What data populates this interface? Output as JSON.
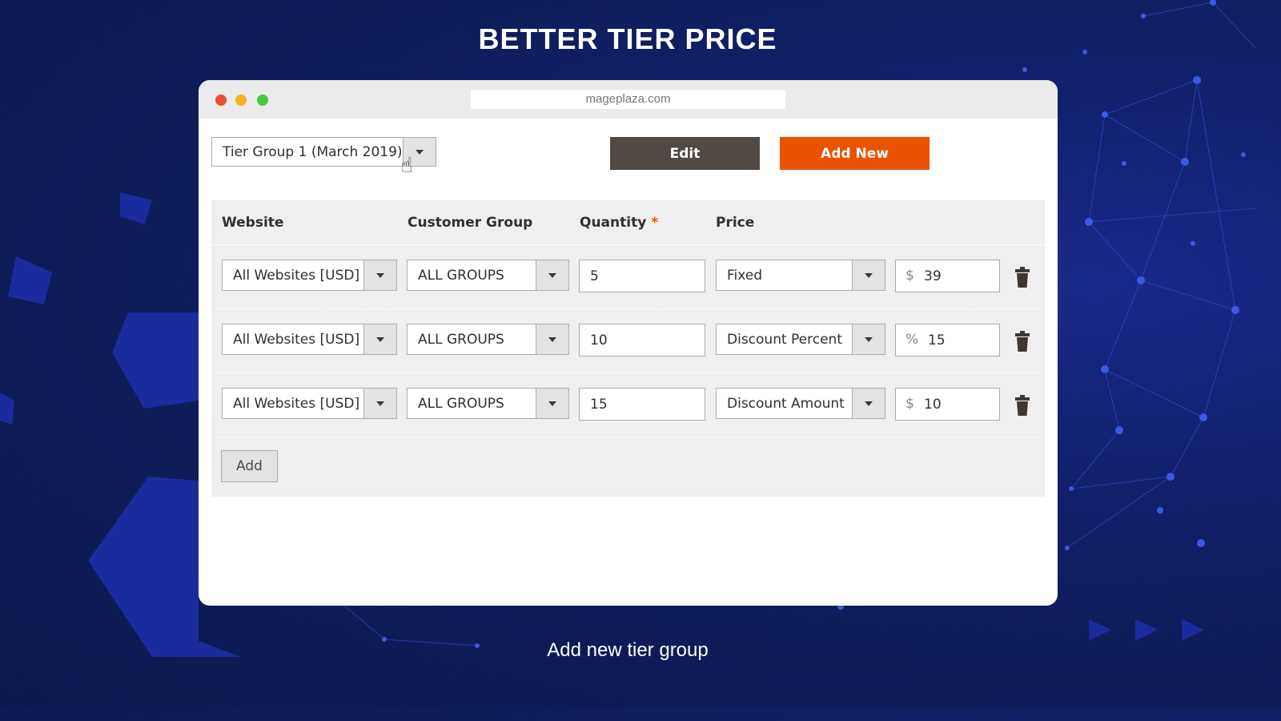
{
  "page": {
    "title": "BETTER TIER PRICE",
    "caption": "Add new tier group"
  },
  "window": {
    "url": "mageplaza.com",
    "traffic_lights": [
      "#ed4b33",
      "#f5b31f",
      "#49c93c"
    ]
  },
  "toolbar": {
    "tier_group_selected": "Tier Group 1 (March 2019)",
    "edit_label": "Edit",
    "add_new_label": "Add New"
  },
  "table": {
    "headers": {
      "website": "Website",
      "customer_group": "Customer Group",
      "quantity": "Quantity",
      "quantity_required": "*",
      "price": "Price"
    },
    "rows": [
      {
        "website": "All Websites [USD]",
        "customer_group": "ALL GROUPS",
        "quantity": "5",
        "price_type": "Fixed",
        "symbol": "$",
        "price": "39"
      },
      {
        "website": "All Websites [USD]",
        "customer_group": "ALL GROUPS",
        "quantity": "10",
        "price_type": "Discount Percent",
        "symbol": "%",
        "price": "15"
      },
      {
        "website": "All Websites [USD]",
        "customer_group": "ALL GROUPS",
        "quantity": "15",
        "price_type": "Discount Amount",
        "symbol": "$",
        "price": "10"
      }
    ],
    "add_label": "Add"
  },
  "colors": {
    "accent": "#eb5202",
    "edit_button": "#514943",
    "background": "#0f1c5a"
  }
}
